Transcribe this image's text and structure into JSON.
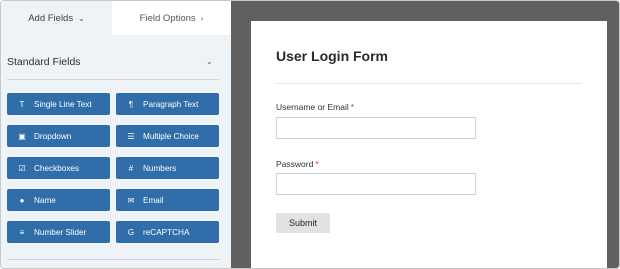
{
  "tabs": {
    "add_fields": "Add Fields",
    "field_options": "Field Options"
  },
  "standard_fields": {
    "title": "Standard Fields",
    "buttons": [
      {
        "label": "Single Line Text",
        "icon": "text-cursor-icon",
        "glyph": "T"
      },
      {
        "label": "Paragraph Text",
        "icon": "paragraph-icon",
        "glyph": "¶"
      },
      {
        "label": "Dropdown",
        "icon": "dropdown-icon",
        "glyph": "▣"
      },
      {
        "label": "Multiple Choice",
        "icon": "list-icon",
        "glyph": "☰"
      },
      {
        "label": "Checkboxes",
        "icon": "checkbox-icon",
        "glyph": "☑"
      },
      {
        "label": "Numbers",
        "icon": "hash-icon",
        "glyph": "#"
      },
      {
        "label": "Name",
        "icon": "user-icon",
        "glyph": "●"
      },
      {
        "label": "Email",
        "icon": "envelope-icon",
        "glyph": "✉"
      },
      {
        "label": "Number Slider",
        "icon": "sliders-icon",
        "glyph": "≡"
      },
      {
        "label": "reCAPTCHA",
        "icon": "google-icon",
        "glyph": "G"
      }
    ]
  },
  "form": {
    "title": "User Login Form",
    "fields": [
      {
        "label": "Username or Email",
        "required_mark": "*",
        "value": ""
      },
      {
        "label": "Password",
        "required_mark": "*",
        "value": ""
      }
    ],
    "submit_label": "Submit"
  },
  "colors": {
    "button_blue": "#2f6ea8",
    "panel_bg": "#eef3f8",
    "preview_bg": "#606060",
    "required": "#d63638"
  }
}
